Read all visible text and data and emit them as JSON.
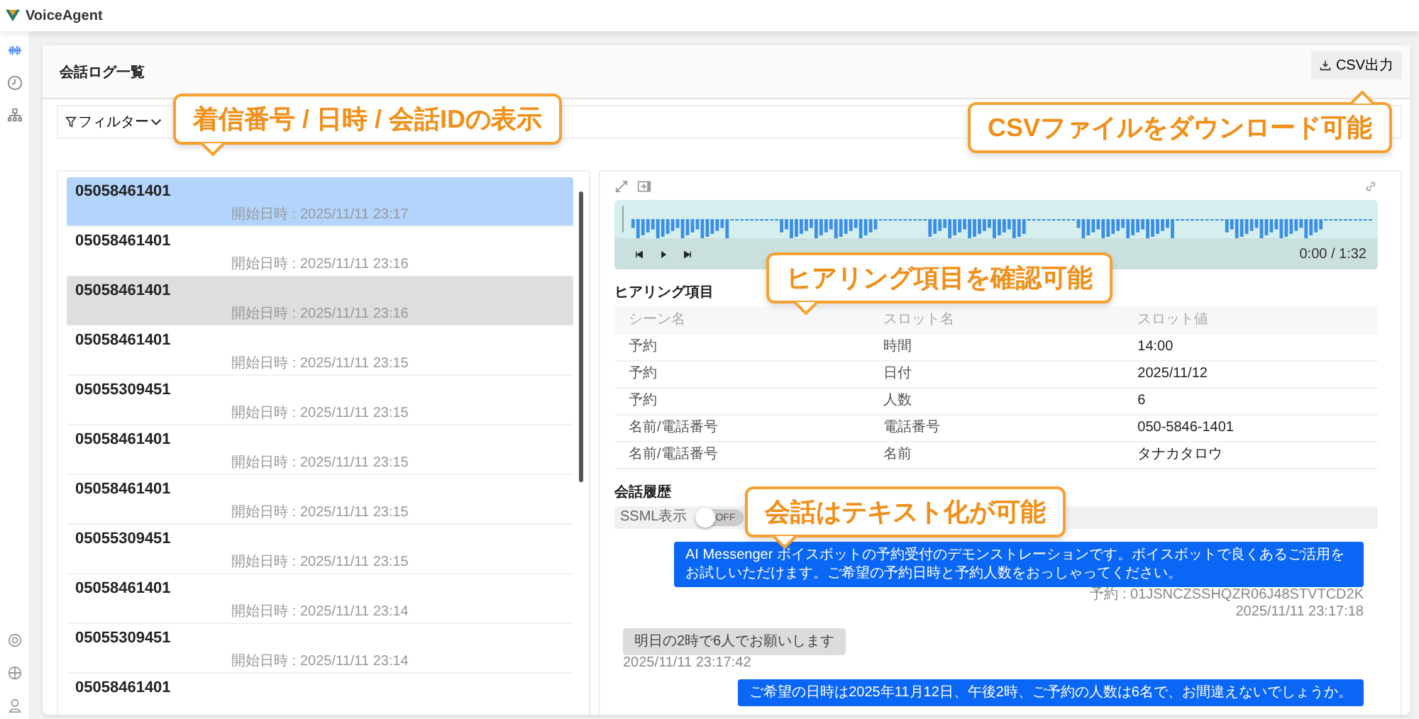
{
  "app": {
    "name": "VoiceAgent"
  },
  "page": {
    "title": "会話ログ一覧",
    "csv_button": "CSV出力"
  },
  "filter": {
    "label": "フィルター"
  },
  "calls": [
    {
      "number": "05058461401",
      "started": "開始日時 : 2025/11/11 23:17",
      "selected": true,
      "highlighted": false
    },
    {
      "number": "05058461401",
      "started": "開始日時 : 2025/11/11 23:16",
      "selected": false,
      "highlighted": false
    },
    {
      "number": "05058461401",
      "started": "開始日時 : 2025/11/11 23:16",
      "selected": false,
      "highlighted": true
    },
    {
      "number": "05058461401",
      "started": "開始日時 : 2025/11/11 23:15",
      "selected": false,
      "highlighted": false
    },
    {
      "number": "05055309451",
      "started": "開始日時 : 2025/11/11 23:15",
      "selected": false,
      "highlighted": false
    },
    {
      "number": "05058461401",
      "started": "開始日時 : 2025/11/11 23:15",
      "selected": false,
      "highlighted": false
    },
    {
      "number": "05058461401",
      "started": "開始日時 : 2025/11/11 23:15",
      "selected": false,
      "highlighted": false
    },
    {
      "number": "05055309451",
      "started": "開始日時 : 2025/11/11 23:15",
      "selected": false,
      "highlighted": false
    },
    {
      "number": "05058461401",
      "started": "開始日時 : 2025/11/11 23:14",
      "selected": false,
      "highlighted": false
    },
    {
      "number": "05055309451",
      "started": "開始日時 : 2025/11/11 23:14",
      "selected": false,
      "highlighted": false
    },
    {
      "number": "05058461401",
      "selected": false,
      "highlighted": false
    }
  ],
  "player": {
    "time": "0:00 / 1:32"
  },
  "hearing": {
    "title": "ヒアリング項目",
    "columns": [
      "シーン名",
      "スロット名",
      "スロット値"
    ],
    "rows": [
      [
        "予約",
        "時間",
        "14:00"
      ],
      [
        "予約",
        "日付",
        "2025/11/12"
      ],
      [
        "予約",
        "人数",
        "6"
      ],
      [
        "名前/電話番号",
        "電話番号",
        "050-5846-1401"
      ],
      [
        "名前/電話番号",
        "名前",
        "タナカタロウ"
      ]
    ]
  },
  "history": {
    "title": "会話履歴",
    "ssml": {
      "label": "SSML表示",
      "on": false,
      "state": "OFF"
    },
    "messages": [
      {
        "kind": "bot",
        "text": "AI Messenger ボイスボットの予約受付のデモンストレーションです。ボイスボットで良くあるご活用をお試しいただけます。ご希望の予約日時と予約人数をおっしゃってください。",
        "meta": [
          "予約 : 01JSNCZSSHQZR06J48STVTCD2K",
          "2025/11/11 23:17:18"
        ]
      },
      {
        "kind": "user",
        "text": "明日の2時で6人でお願いします",
        "meta": [
          "2025/11/11 23:17:42"
        ]
      },
      {
        "kind": "bot",
        "text": "ご希望の日時は2025年11月12日、午後2時、ご予約の人数は6名で、お間違えないでしょうか。"
      }
    ]
  },
  "callouts": [
    {
      "text": "着信番号 / 日時 / 会話IDの表示"
    },
    {
      "text": "CSVファイルをダウンロード可能"
    },
    {
      "text": "ヒアリング項目を確認可能"
    },
    {
      "text": "会話はテキスト化が可能"
    }
  ]
}
